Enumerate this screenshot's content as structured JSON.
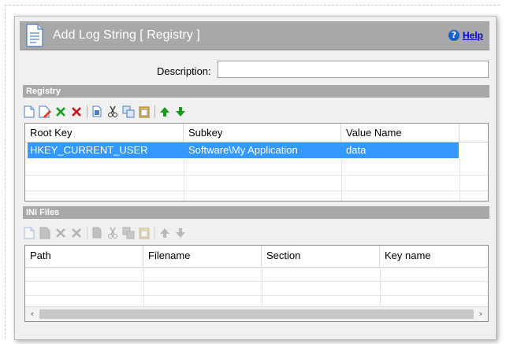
{
  "header": {
    "title": "Add Log String [ Registry ]",
    "help_icon": "?",
    "help_label": "Help"
  },
  "description": {
    "label": "Description:",
    "value": ""
  },
  "registry": {
    "section_title": "Registry",
    "toolbar": [
      "new-icon",
      "edit-icon",
      "check-icon",
      "delete-icon",
      "copy-icon",
      "cut-icon",
      "duplicate-icon",
      "paste-icon",
      "move-up-icon",
      "move-down-icon"
    ],
    "columns": [
      "Root Key",
      "Subkey",
      "Value Name"
    ],
    "rows": [
      {
        "root_key": "HKEY_CURRENT_USER",
        "subkey": "Software\\My Application",
        "value_name": "data"
      }
    ]
  },
  "ini_files": {
    "section_title": "INI Files",
    "toolbar": [
      "new-icon",
      "save-icon",
      "check-icon",
      "delete-icon",
      "copy-icon",
      "cut-icon",
      "duplicate-icon",
      "paste-icon",
      "move-up-icon",
      "move-down-icon"
    ],
    "columns": [
      "Path",
      "Filename",
      "Section",
      "Key name"
    ],
    "scroll_left": "‹",
    "scroll_right": "›"
  },
  "colors": {
    "header_bg": "#a8a8a8",
    "selection": "#3399ff",
    "accept_green": "#1a9a1a",
    "delete_red": "#d01010",
    "link_blue": "#0000cc"
  }
}
